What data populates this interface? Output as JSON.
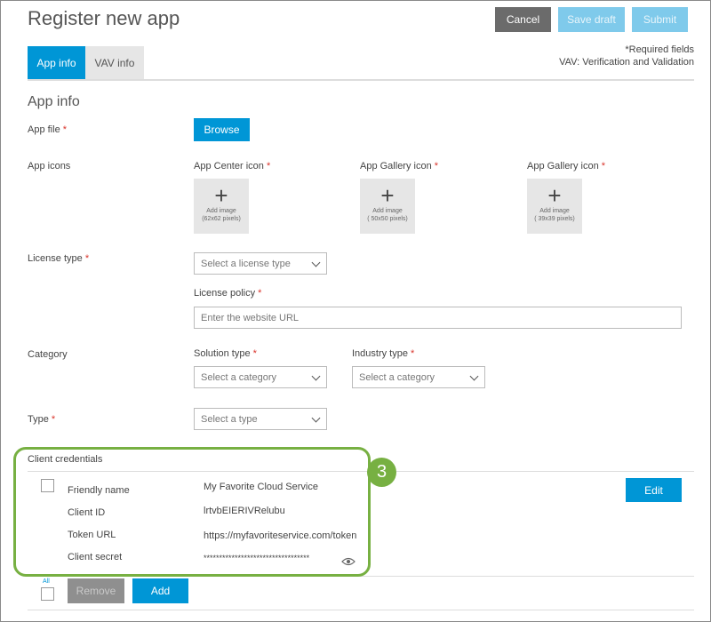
{
  "header": {
    "title": "Register new app",
    "cancel_label": "Cancel",
    "save_draft_label": "Save draft",
    "submit_label": "Submit"
  },
  "tabs": [
    {
      "label": "App info",
      "active": true
    },
    {
      "label": "VAV info",
      "active": false
    }
  ],
  "notes": {
    "required": "*Required fields",
    "vav": "VAV: Verification and Validation"
  },
  "section_title": "App info",
  "app_file": {
    "label": "App file",
    "asterisk": "*",
    "browse_label": "Browse"
  },
  "app_icons": {
    "label": "App icons",
    "items": [
      {
        "label": "App Center icon",
        "asterisk": "*",
        "add": "Add image",
        "size": "(62x62 pixels)"
      },
      {
        "label": "App Gallery icon",
        "asterisk": "*",
        "add": "Add image",
        "size": "( 50x50 pixels)"
      },
      {
        "label": "App Gallery icon",
        "asterisk": "*",
        "add": "Add image",
        "size": "( 39x39 pixels)"
      }
    ]
  },
  "license": {
    "label": "License type",
    "asterisk": "*",
    "select_value": "Select a license type",
    "policy_label": "License policy",
    "policy_asterisk": "*",
    "policy_placeholder": "Enter the website URL"
  },
  "category": {
    "label": "Category",
    "solution_label": "Solution type",
    "solution_asterisk": "*",
    "solution_value": "Select a category",
    "industry_label": "Industry type",
    "industry_asterisk": "*",
    "industry_value": "Select a category"
  },
  "type": {
    "label": "Type",
    "asterisk": "*",
    "select_value": "Select a type"
  },
  "client_credentials": {
    "title": "Client credentials",
    "rows": [
      {
        "key": "Friendly name",
        "value": "My Favorite Cloud Service"
      },
      {
        "key": "Client ID",
        "value": "lrtvbEIERIVRelubu"
      },
      {
        "key": "Token URL",
        "value": "https://myfavoriteservice.com/token"
      },
      {
        "key": "Client secret",
        "value": "**********************************"
      }
    ],
    "edit_label": "Edit",
    "all_label": "All",
    "remove_label": "Remove",
    "add_label": "Add"
  },
  "callout_number": "3",
  "colors": {
    "accent": "#0096d6",
    "highlight": "#77b042",
    "required": "#d9342b"
  }
}
